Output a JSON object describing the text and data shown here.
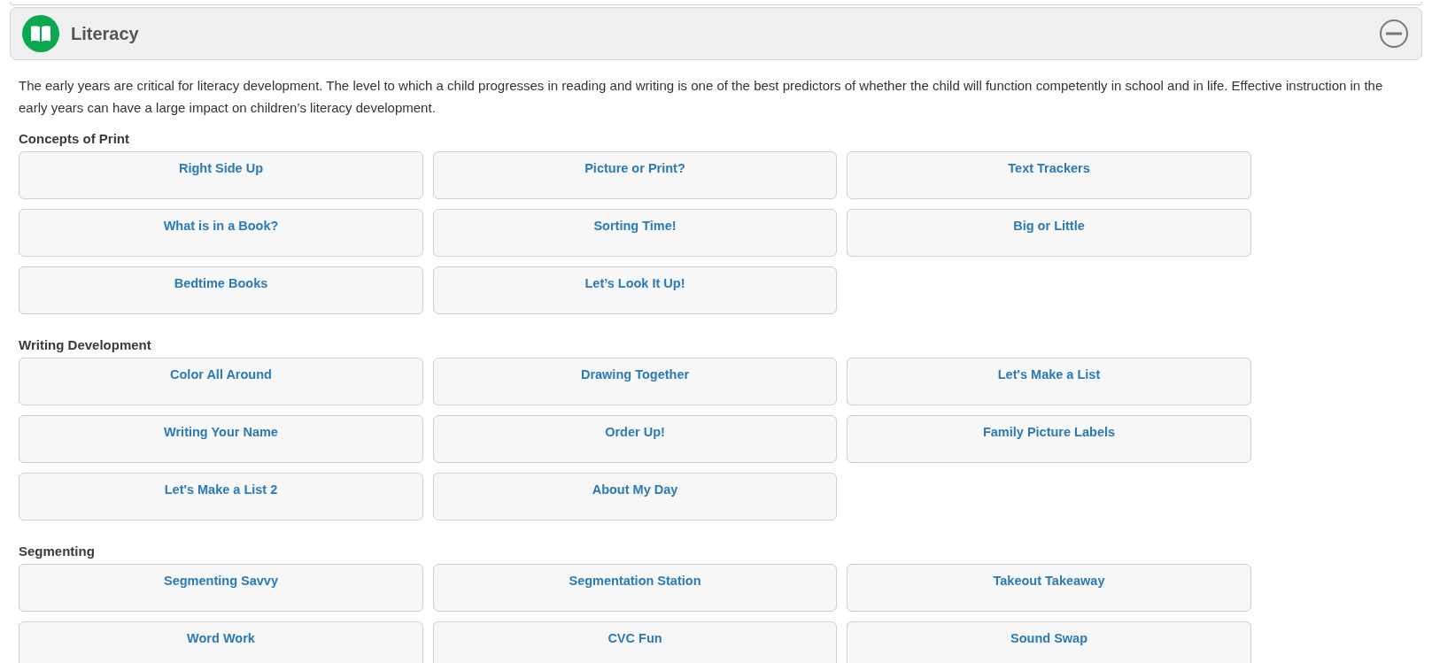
{
  "panel": {
    "title": "Literacy",
    "expanded": true,
    "description": "The early years are critical for literacy development. The level to which a child progresses in reading and writing is one of the best predictors of whether the child will function competently in school and in life. Effective instruction in the early years can have a large impact on children’s literacy development.",
    "sections": [
      {
        "heading": "Concepts of Print",
        "activities": [
          "Right Side Up",
          "Picture or Print?",
          "Text Trackers",
          "What is in a Book?",
          "Sorting Time!",
          "Big or Little",
          "Bedtime Books",
          "Let’s Look It Up!"
        ]
      },
      {
        "heading": "Writing Development",
        "activities": [
          "Color All Around",
          "Drawing Together",
          "Let's Make a List",
          "Writing Your Name",
          "Order Up!",
          "Family Picture Labels",
          "Let's Make a List 2",
          "About My Day"
        ]
      },
      {
        "heading": "Segmenting",
        "activities": [
          "Segmenting Savvy",
          "Segmentation Station",
          "Takeout Takeaway",
          "Word Work",
          "CVC Fun",
          "Sound Swap"
        ]
      }
    ]
  }
}
